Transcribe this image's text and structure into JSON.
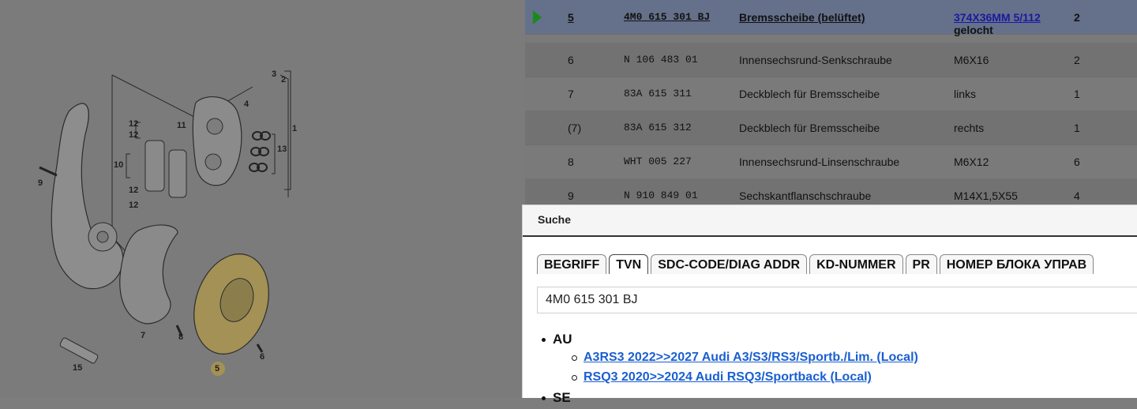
{
  "diagram": {
    "callouts": [
      "1",
      "2",
      "3",
      "4",
      "5",
      "6",
      "7",
      "8",
      "9",
      "10",
      "11",
      "12",
      "12",
      "12",
      "12",
      "13",
      "15"
    ]
  },
  "parts_table": {
    "rows": [
      {
        "pos": "5",
        "part_number": "4M0 615 301 BJ",
        "description": "Bremsscheibe (belüftet)",
        "remark_line1": "374X36MM 5/112",
        "remark_line2": "gelocht",
        "qty": "2",
        "selected": true
      },
      {
        "pos": "6",
        "part_number": "N   106 483 01",
        "description": "Innensechsrund-Senkschraube",
        "remark_line1": "M6X16",
        "qty": "2"
      },
      {
        "pos": "7",
        "part_number": "83A 615 311",
        "description": "Deckblech für Bremsscheibe",
        "remark_line1": "links",
        "qty": "1"
      },
      {
        "pos": "(7)",
        "part_number": "83A 615 312",
        "description": "Deckblech für Bremsscheibe",
        "remark_line1": "rechts",
        "qty": "1"
      },
      {
        "pos": "8",
        "part_number": "WHT 005 227",
        "description": "Innensechsrund-Linsenschraube",
        "remark_line1": "M6X12",
        "qty": "6"
      },
      {
        "pos": "9",
        "part_number": "N   910 849 01",
        "description": "Sechskantflanschschraube",
        "remark_line1": "M14X1,5X55",
        "qty": "4"
      }
    ]
  },
  "search_dialog": {
    "title": "Suche",
    "tabs": [
      "BEGRIFF",
      "TVN",
      "SDC-CODE/DIAG ADDR",
      "KD-NUMMER",
      "PR",
      "НОМЕР БЛОКА УПРАВ"
    ],
    "active_tab": "TVN",
    "input_value": "4M0 615 301 BJ",
    "results": [
      {
        "group": "AU",
        "links": [
          "A3RS3 2022>>2027 Audi A3/S3/RS3/Sportb./Lim. (Local)",
          "RSQ3 2020>>2024 Audi RSQ3/Sportback (Local)"
        ]
      },
      {
        "group": "SE",
        "links": []
      }
    ]
  },
  "colors": {
    "overlay": "#7b7b7b",
    "selected_row": "#65708a",
    "link": "#1a5fd0",
    "arrow": "#1b8a1b",
    "highlight_part": "#a39155"
  }
}
